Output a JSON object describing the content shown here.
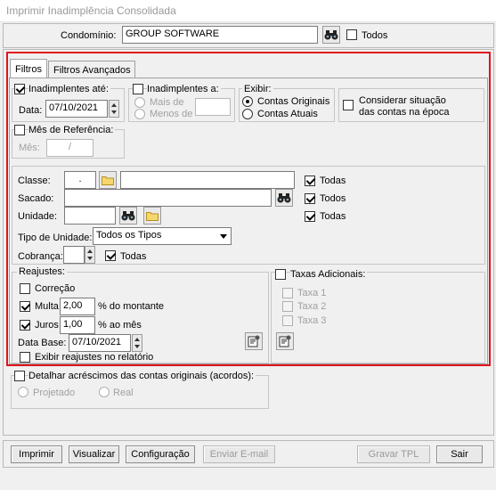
{
  "window": {
    "title": "Imprimir Inadimplência Consolidada"
  },
  "condominio": {
    "label": "Condomínio:",
    "value": "GROUP SOFTWARE",
    "todos_label": "Todos"
  },
  "tabs": [
    {
      "label": "Filtros"
    },
    {
      "label": "Filtros Avançados"
    }
  ],
  "inadimplentes_ate": {
    "label": "Inadimplentes até:",
    "data_label": "Data:",
    "data_value": "07/10/2021"
  },
  "inadimplentes_a": {
    "label": "Inadimplentes a:",
    "mais_de": "Mais de",
    "menos_de": "Menos de"
  },
  "exibir": {
    "label": "Exibir:",
    "originais": "Contas Originais",
    "atuais": "Contas Atuais"
  },
  "considerar": {
    "line1": "Considerar situação",
    "line2": "das contas na época"
  },
  "mes_ref": {
    "label": "Mês de Referência:",
    "mes_label": "Mês:",
    "mes_value": "/"
  },
  "classe": {
    "label": "Classe:",
    "value": ".",
    "todas": "Todas"
  },
  "sacado": {
    "label": "Sacado:",
    "todos": "Todos"
  },
  "unidade": {
    "label": "Unidade:",
    "todas": "Todas"
  },
  "tipo_unidade": {
    "label": "Tipo de Unidade:",
    "value": "Todos os Tipos"
  },
  "cobranca": {
    "label": "Cobrança:",
    "todas": "Todas"
  },
  "reajustes": {
    "label": "Reajustes:",
    "correcao": "Correção",
    "multa": "Multa",
    "multa_value": "2,00",
    "multa_suffix": "% do montante",
    "juros": "Juros",
    "juros_value": "1,00",
    "juros_suffix": "% ao mês",
    "data_base_label": "Data Base:",
    "data_base_value": "07/10/2021",
    "exibir_reajustes": "Exibir reajustes no relatório"
  },
  "taxas": {
    "label": "Taxas Adicionais:",
    "items": [
      "Taxa 1",
      "Taxa 2",
      "Taxa 3"
    ]
  },
  "detalhar": {
    "label": "Detalhar acréscimos das contas originais (acordos):",
    "projetado": "Projetado",
    "real": "Real"
  },
  "buttons": {
    "imprimir": "Imprimir",
    "visualizar": "Visualizar",
    "configuracao": "Configuração",
    "enviar": "Enviar E-mail",
    "gravar": "Gravar TPL",
    "sair": "Sair"
  },
  "colors": {
    "highlight": "#e0141e",
    "background": "#f0f0f0"
  },
  "icons": [
    "binoculars-icon",
    "folder-icon",
    "settings-sheet-icon"
  ]
}
